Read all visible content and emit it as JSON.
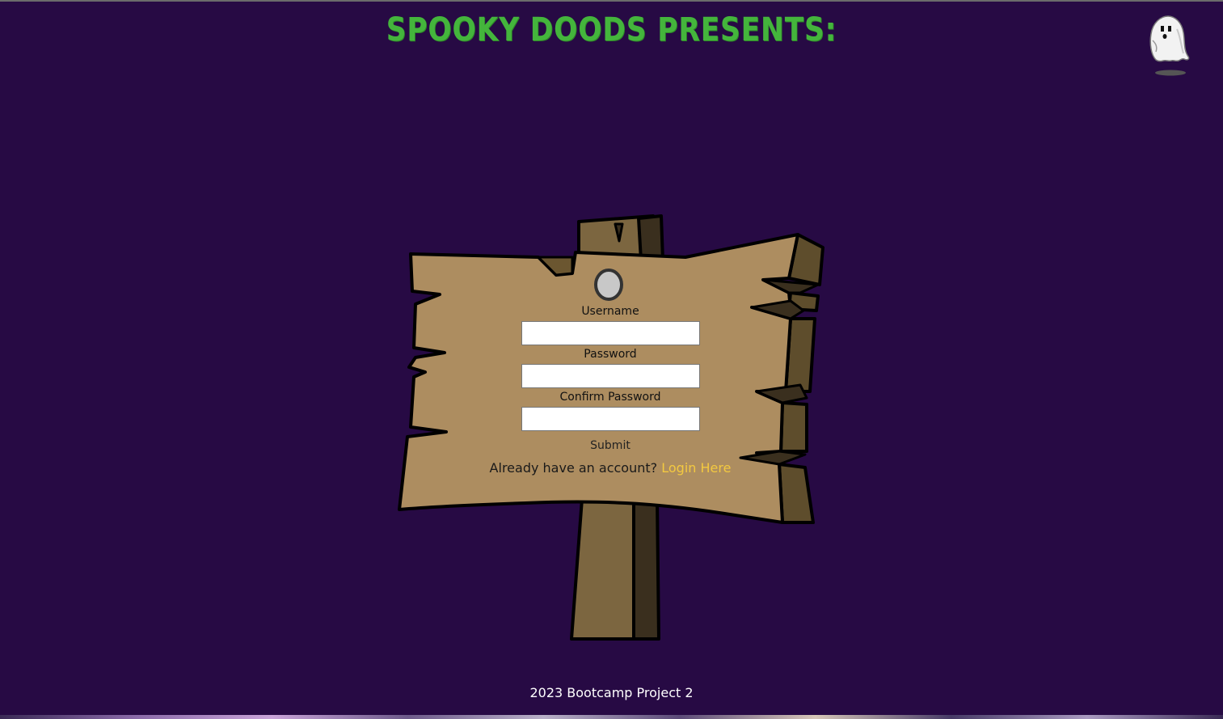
{
  "header": {
    "title": "SPOOKY DOODS PRESENTS:"
  },
  "form": {
    "username_label": "Username",
    "password_label": "Password",
    "confirm_password_label": "Confirm Password",
    "username_value": "",
    "password_value": "",
    "confirm_password_value": "",
    "submit_label": "Submit",
    "login_prompt": "Already have an account?",
    "login_link": "Login Here"
  },
  "footer": {
    "text": "2023 Bootcamp Project 2"
  },
  "icons": {
    "ghost": "ghost-icon",
    "sign": "wooden-sign-icon"
  },
  "colors": {
    "background": "#270a44",
    "title": "#44b53c",
    "link": "#f3c940",
    "sign_wood": "#ad8d60",
    "footer_text": "#ffffff"
  }
}
